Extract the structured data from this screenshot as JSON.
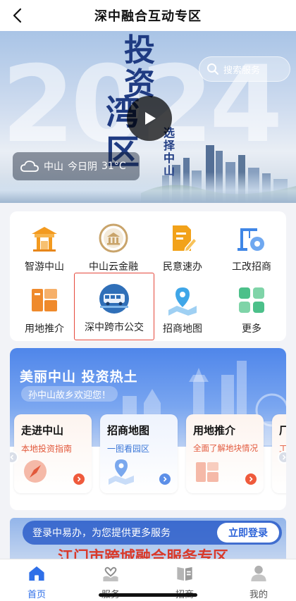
{
  "nav": {
    "title": "深中融合互动专区"
  },
  "hero": {
    "year_text": "2024",
    "calligraphy_1": "投资",
    "calligraphy_2": "湾区",
    "vertical_text": "选择中山",
    "search_placeholder": "搜索服务",
    "weather": {
      "city": "中山",
      "day": "今日阴",
      "temp": "31°C"
    }
  },
  "services": [
    {
      "label": "智游中山",
      "icon": "pavilion-icon",
      "color": "#f39a1f"
    },
    {
      "label": "中山云金融",
      "icon": "finance-coin-icon",
      "color": "#c9a46b"
    },
    {
      "label": "民意速办",
      "icon": "document-pen-icon",
      "color": "#f2a21a"
    },
    {
      "label": "工改招商",
      "icon": "crane-gear-icon",
      "color": "#3f86e6"
    },
    {
      "label": "用地推介",
      "icon": "land-plots-icon",
      "color": "#ef8a2c"
    },
    {
      "label": "深中跨市公交",
      "icon": "bus-icon",
      "color": "#2f6fb8",
      "selected": true
    },
    {
      "label": "招商地图",
      "icon": "map-pin-icon",
      "color": "#3fa6e8"
    },
    {
      "label": "更多",
      "icon": "more-grid-icon",
      "color": "#4cc08a"
    }
  ],
  "invest": {
    "title": "美丽中山 投资热土",
    "subtitle": "孙中山故乡欢迎您！",
    "cards": [
      {
        "title": "走进中山",
        "subtitle": "本地投资指南",
        "sub_color": "#e2583b",
        "icon": "compass-icon"
      },
      {
        "title": "招商地图",
        "subtitle": "一图看园区",
        "sub_color": "#3c78d8",
        "icon": "map-pin-icon"
      },
      {
        "title": "用地推介",
        "subtitle": "全面了解地块情况",
        "sub_color": "#e2583b",
        "icon": "land-plots-icon"
      },
      {
        "title": "厂",
        "subtitle": "工",
        "sub_color": "#e2583b",
        "icon": "factory-icon"
      }
    ]
  },
  "login": {
    "prompt": "登录中易办，为您提供更多服务",
    "button": "立即登录",
    "jiangmen_banner": "江门市跨城融合服务专区"
  },
  "tabs": [
    {
      "label": "首页",
      "icon": "home-icon",
      "active": true
    },
    {
      "label": "服务",
      "icon": "service-hands-icon"
    },
    {
      "label": "招商",
      "icon": "business-book-icon"
    },
    {
      "label": "我的",
      "icon": "profile-icon"
    }
  ],
  "colors": {
    "accent": "#2f6fe8",
    "selected_border": "#e5483c"
  }
}
